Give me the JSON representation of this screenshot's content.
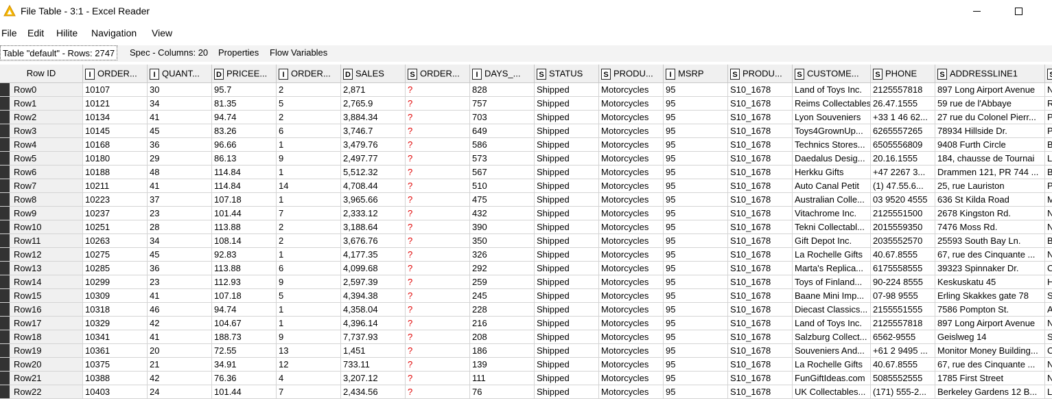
{
  "window": {
    "title": "File Table - 3:1 - Excel Reader",
    "icon": "warning-triangle-icon",
    "icon_color": "#f5b800"
  },
  "menu": [
    "File",
    "Edit",
    "Hilite",
    "Navigation",
    "View"
  ],
  "tabs": [
    {
      "label": "Table \"default\" - Rows: 2747",
      "active": true
    },
    {
      "label": "Spec - Columns: 20",
      "active": false
    },
    {
      "label": "Properties",
      "active": false
    },
    {
      "label": "Flow Variables",
      "active": false
    }
  ],
  "table": {
    "rowid_header": "Row ID",
    "columns": [
      {
        "type": "I",
        "name": "ORDER..."
      },
      {
        "type": "I",
        "name": "QUANT..."
      },
      {
        "type": "D",
        "name": "PRICEE..."
      },
      {
        "type": "I",
        "name": "ORDER..."
      },
      {
        "type": "D",
        "name": "SALES"
      },
      {
        "type": "S",
        "name": "ORDER..."
      },
      {
        "type": "I",
        "name": "DAYS_..."
      },
      {
        "type": "S",
        "name": "STATUS"
      },
      {
        "type": "S",
        "name": "PRODU..."
      },
      {
        "type": "I",
        "name": "MSRP"
      },
      {
        "type": "S",
        "name": "PRODU..."
      },
      {
        "type": "S",
        "name": "CUSTOME..."
      },
      {
        "type": "S",
        "name": "PHONE"
      },
      {
        "type": "S",
        "name": "ADDRESSLINE1"
      },
      {
        "type": "S",
        "name": ""
      }
    ],
    "missing_marker": "?",
    "missing_color": "#e00000",
    "rows": [
      [
        "Row0",
        "10107",
        "30",
        "95.7",
        "2",
        "2,871",
        "?",
        "828",
        "Shipped",
        "Motorcycles",
        "95",
        "S10_1678",
        "Land of Toys Inc.",
        "2125557818",
        "897 Long Airport Avenue",
        "NY"
      ],
      [
        "Row1",
        "10121",
        "34",
        "81.35",
        "5",
        "2,765.9",
        "?",
        "757",
        "Shipped",
        "Motorcycles",
        "95",
        "S10_1678",
        "Reims Collectables",
        "26.47.1555",
        "59 rue de l'Abbaye",
        "Re"
      ],
      [
        "Row2",
        "10134",
        "41",
        "94.74",
        "2",
        "3,884.34",
        "?",
        "703",
        "Shipped",
        "Motorcycles",
        "95",
        "S10_1678",
        "Lyon Souveniers",
        "+33 1 46 62...",
        "27 rue du Colonel Pierr...",
        "Pa"
      ],
      [
        "Row3",
        "10145",
        "45",
        "83.26",
        "6",
        "3,746.7",
        "?",
        "649",
        "Shipped",
        "Motorcycles",
        "95",
        "S10_1678",
        "Toys4GrownUp...",
        "6265557265",
        "78934 Hillside Dr.",
        "Pa"
      ],
      [
        "Row4",
        "10168",
        "36",
        "96.66",
        "1",
        "3,479.76",
        "?",
        "586",
        "Shipped",
        "Motorcycles",
        "95",
        "S10_1678",
        "Technics Stores...",
        "6505556809",
        "9408 Furth Circle",
        "Bu"
      ],
      [
        "Row5",
        "10180",
        "29",
        "86.13",
        "9",
        "2,497.77",
        "?",
        "573",
        "Shipped",
        "Motorcycles",
        "95",
        "S10_1678",
        "Daedalus Desig...",
        "20.16.1555",
        "184, chausse de Tournai",
        "Lil"
      ],
      [
        "Row6",
        "10188",
        "48",
        "114.84",
        "1",
        "5,512.32",
        "?",
        "567",
        "Shipped",
        "Motorcycles",
        "95",
        "S10_1678",
        "Herkku Gifts",
        "+47 2267 3...",
        "Drammen 121, PR 744 ...",
        "Be"
      ],
      [
        "Row7",
        "10211",
        "41",
        "114.84",
        "14",
        "4,708.44",
        "?",
        "510",
        "Shipped",
        "Motorcycles",
        "95",
        "S10_1678",
        "Auto Canal Petit",
        "(1) 47.55.6...",
        "25, rue Lauriston",
        "Pa"
      ],
      [
        "Row8",
        "10223",
        "37",
        "107.18",
        "1",
        "3,965.66",
        "?",
        "475",
        "Shipped",
        "Motorcycles",
        "95",
        "S10_1678",
        "Australian Colle...",
        "03 9520 4555",
        "636 St Kilda Road",
        "Me"
      ],
      [
        "Row9",
        "10237",
        "23",
        "101.44",
        "7",
        "2,333.12",
        "?",
        "432",
        "Shipped",
        "Motorcycles",
        "95",
        "S10_1678",
        "Vitachrome Inc.",
        "2125551500",
        "2678 Kingston Rd.",
        "NY"
      ],
      [
        "Row10",
        "10251",
        "28",
        "113.88",
        "2",
        "3,188.64",
        "?",
        "390",
        "Shipped",
        "Motorcycles",
        "95",
        "S10_1678",
        "Tekni Collectabl...",
        "2015559350",
        "7476 Moss Rd.",
        "Ne"
      ],
      [
        "Row11",
        "10263",
        "34",
        "108.14",
        "2",
        "3,676.76",
        "?",
        "350",
        "Shipped",
        "Motorcycles",
        "95",
        "S10_1678",
        "Gift Depot Inc.",
        "2035552570",
        "25593 South Bay Ln.",
        "Br"
      ],
      [
        "Row12",
        "10275",
        "45",
        "92.83",
        "1",
        "4,177.35",
        "?",
        "326",
        "Shipped",
        "Motorcycles",
        "95",
        "S10_1678",
        "La Rochelle Gifts",
        "40.67.8555",
        "67, rue des Cinquante ...",
        "Na"
      ],
      [
        "Row13",
        "10285",
        "36",
        "113.88",
        "6",
        "4,099.68",
        "?",
        "292",
        "Shipped",
        "Motorcycles",
        "95",
        "S10_1678",
        "Marta's Replica...",
        "6175558555",
        "39323 Spinnaker Dr.",
        "Ca"
      ],
      [
        "Row14",
        "10299",
        "23",
        "112.93",
        "9",
        "2,597.39",
        "?",
        "259",
        "Shipped",
        "Motorcycles",
        "95",
        "S10_1678",
        "Toys of Finland...",
        "90-224 8555",
        "Keskuskatu 45",
        "He"
      ],
      [
        "Row15",
        "10309",
        "41",
        "107.18",
        "5",
        "4,394.38",
        "?",
        "245",
        "Shipped",
        "Motorcycles",
        "95",
        "S10_1678",
        "Baane Mini Imp...",
        "07-98 9555",
        "Erling Skakkes gate 78",
        "St"
      ],
      [
        "Row16",
        "10318",
        "46",
        "94.74",
        "1",
        "4,358.04",
        "?",
        "228",
        "Shipped",
        "Motorcycles",
        "95",
        "S10_1678",
        "Diecast Classics...",
        "2155551555",
        "7586 Pompton St.",
        "All"
      ],
      [
        "Row17",
        "10329",
        "42",
        "104.67",
        "1",
        "4,396.14",
        "?",
        "216",
        "Shipped",
        "Motorcycles",
        "95",
        "S10_1678",
        "Land of Toys Inc.",
        "2125557818",
        "897 Long Airport Avenue",
        "NY"
      ],
      [
        "Row18",
        "10341",
        "41",
        "188.73",
        "9",
        "7,737.93",
        "?",
        "208",
        "Shipped",
        "Motorcycles",
        "95",
        "S10_1678",
        "Salzburg Collect...",
        "6562-9555",
        "Geislweg 14",
        "Sa"
      ],
      [
        "Row19",
        "10361",
        "20",
        "72.55",
        "13",
        "1,451",
        "?",
        "186",
        "Shipped",
        "Motorcycles",
        "95",
        "S10_1678",
        "Souveniers And...",
        "+61 2 9495 ...",
        "Monitor Money Building...",
        "Ch"
      ],
      [
        "Row20",
        "10375",
        "21",
        "34.91",
        "12",
        "733.11",
        "?",
        "139",
        "Shipped",
        "Motorcycles",
        "95",
        "S10_1678",
        "La Rochelle Gifts",
        "40.67.8555",
        "67, rue des Cinquante ...",
        "Na"
      ],
      [
        "Row21",
        "10388",
        "42",
        "76.36",
        "4",
        "3,207.12",
        "?",
        "111",
        "Shipped",
        "Motorcycles",
        "95",
        "S10_1678",
        "FunGiftIdeas.com",
        "5085552555",
        "1785 First Street",
        "Ne"
      ],
      [
        "Row22",
        "10403",
        "24",
        "101.44",
        "7",
        "2,434.56",
        "?",
        "76",
        "Shipped",
        "Motorcycles",
        "95",
        "S10_1678",
        "UK Collectables...",
        "(171) 555-2...",
        "Berkeley Gardens 12 B...",
        "Liv"
      ]
    ]
  }
}
